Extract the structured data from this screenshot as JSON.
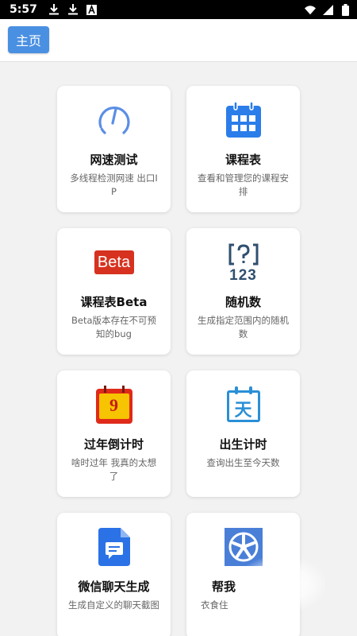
{
  "status_bar": {
    "time": "5:57",
    "left_icons": [
      "download-icon",
      "download-icon",
      "accessibility-icon"
    ],
    "right_icons": [
      "wifi-icon",
      "signal-icon",
      "battery-icon"
    ]
  },
  "app_bar": {
    "home_label": "主页",
    "accent": "#4a90e2"
  },
  "cards": [
    {
      "icon": "speedometer-icon",
      "title": "网速测试",
      "desc": "多线程检测网速 出口IP"
    },
    {
      "icon": "calendar-icon",
      "title": "课程表",
      "desc": "查看和管理您的课程安排"
    },
    {
      "icon": "beta-badge-icon",
      "icon_text": "Beta",
      "title": "课程表Beta",
      "desc": "Beta版本存在不可预知的bug"
    },
    {
      "icon": "random-number-icon",
      "icon_text": "123",
      "title": "随机数",
      "desc": "生成指定范围内的随机数"
    },
    {
      "icon": "new-year-calendar-icon",
      "icon_text": "9",
      "title": "过年倒计时",
      "desc": "啥时过年 我真的太想了"
    },
    {
      "icon": "day-calendar-icon",
      "icon_text": "天",
      "title": "出生计时",
      "desc": "查询出生至今天数"
    },
    {
      "icon": "chat-document-icon",
      "title": "微信聊天生成",
      "desc": "生成自定义的聊天截图"
    },
    {
      "icon": "wheel-icon",
      "title": "帮我",
      "desc": "衣食住"
    }
  ]
}
